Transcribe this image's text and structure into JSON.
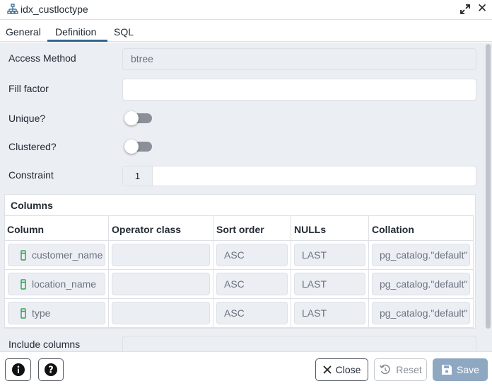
{
  "window": {
    "title": "idx_custloctype"
  },
  "tabs": [
    {
      "label": "General"
    },
    {
      "label": "Definition",
      "active": true
    },
    {
      "label": "SQL"
    }
  ],
  "form": {
    "access_method": {
      "label": "Access Method",
      "value": "btree"
    },
    "fill_factor": {
      "label": "Fill factor",
      "value": ""
    },
    "unique": {
      "label": "Unique?",
      "checked": false
    },
    "clustered": {
      "label": "Clustered?",
      "checked": false
    },
    "constraint": {
      "label": "Constraint",
      "value": "1"
    },
    "include_columns": {
      "label": "Include columns",
      "value": ""
    }
  },
  "columns": {
    "title": "Columns",
    "headers": [
      "Column",
      "Operator class",
      "Sort order",
      "NULLs",
      "Collation"
    ],
    "rows": [
      {
        "column": "customer_name",
        "operator_class": "",
        "sort_order": "ASC",
        "nulls": "LAST",
        "collation": "pg_catalog.\"default\""
      },
      {
        "column": "location_name",
        "operator_class": "",
        "sort_order": "ASC",
        "nulls": "LAST",
        "collation": "pg_catalog.\"default\""
      },
      {
        "column": "type",
        "operator_class": "",
        "sort_order": "ASC",
        "nulls": "LAST",
        "collation": "pg_catalog.\"default\""
      }
    ]
  },
  "footer": {
    "info_icon": "info-icon",
    "help_icon": "help-icon",
    "close_label": "Close",
    "reset_label": "Reset",
    "save_label": "Save"
  },
  "colors": {
    "accent": "#326690",
    "panel_bg": "#ebeef3",
    "save_disabled": "#8fa8c2",
    "column_icon": "#2e9e4f"
  }
}
